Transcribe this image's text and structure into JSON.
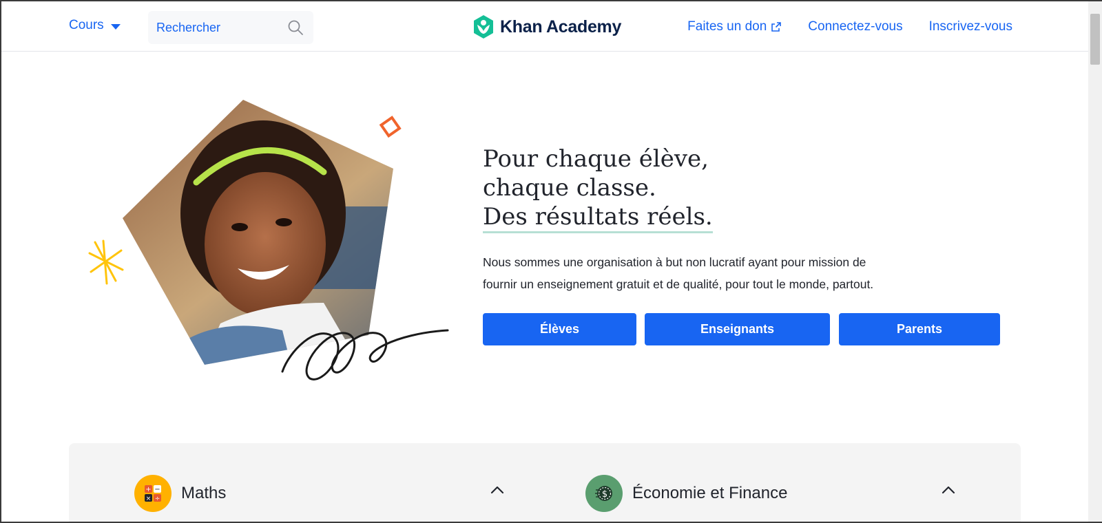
{
  "header": {
    "courses_label": "Cours",
    "search_placeholder": "Rechercher",
    "logo_text": "Khan Academy",
    "donate_label": "Faites un don",
    "login_label": "Connectez-vous",
    "signup_label": "Inscrivez-vous"
  },
  "hero": {
    "headline_line1": "Pour chaque élève,",
    "headline_line2": "chaque classe.",
    "headline_line3": "Des résultats réels.",
    "mission_line1": "Nous sommes une organisation à but non lucratif ayant pour mission de",
    "mission_line2": "fournir un enseignement gratuit et de qualité, pour tout le monde, partout.",
    "buttons": {
      "students": "Élèves",
      "teachers": "Enseignants",
      "parents": "Parents"
    }
  },
  "subjects": [
    {
      "title": "Maths",
      "icon": "calculator-icon",
      "icon_color": "#ffb100"
    },
    {
      "title": "Économie et Finance",
      "icon": "coin-icon",
      "icon_color": "#5a9e6f"
    }
  ],
  "colors": {
    "accent": "#1865f2",
    "logo_green": "#14bf96",
    "logo_text": "#0b2149",
    "decor_orange": "#f0642c",
    "decor_yellow": "#ffc40c",
    "underline": "#b6dfd4"
  }
}
